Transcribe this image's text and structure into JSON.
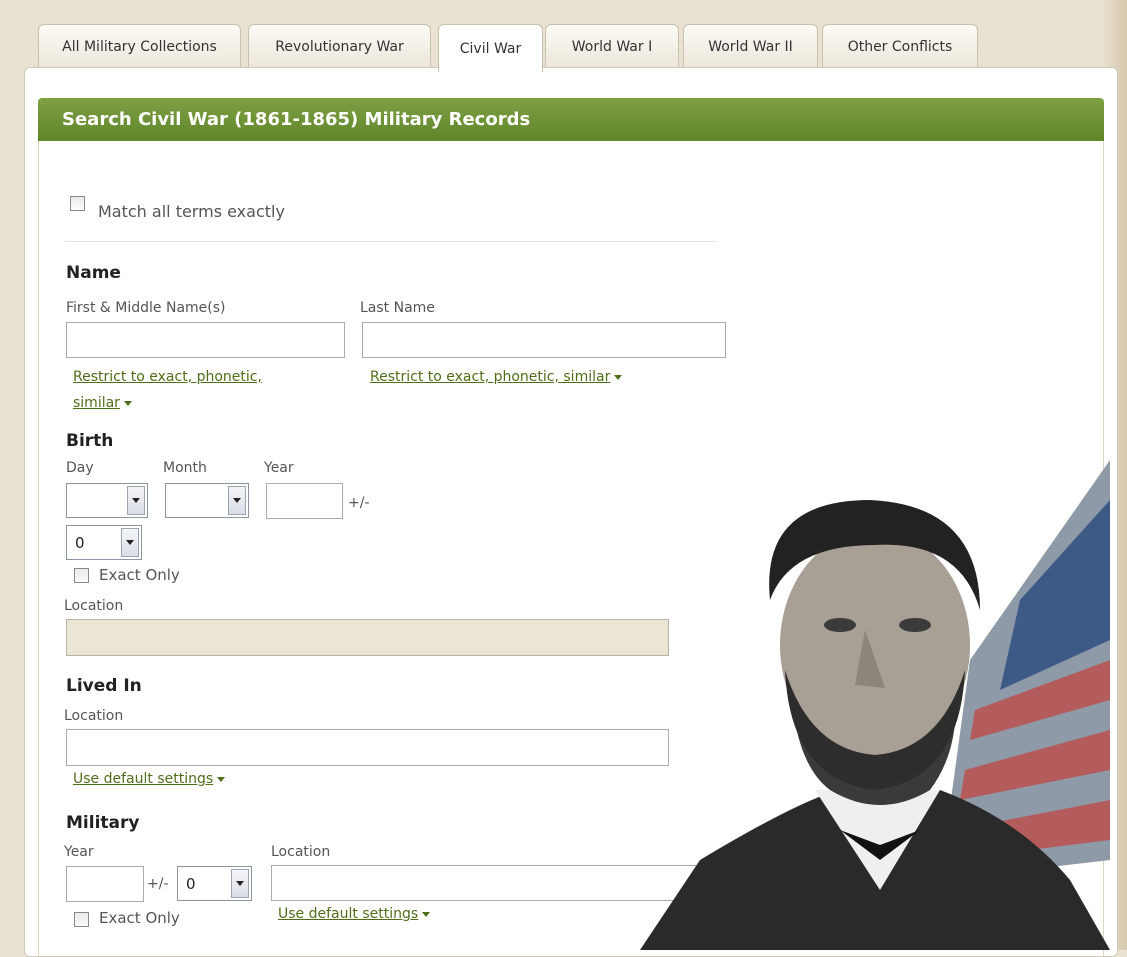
{
  "tabs": [
    {
      "label": "All Military Collections",
      "active": false
    },
    {
      "label": "Revolutionary War",
      "active": false
    },
    {
      "label": "Civil War",
      "active": true
    },
    {
      "label": "World War I",
      "active": false
    },
    {
      "label": "World War II",
      "active": false
    },
    {
      "label": "Other Conflicts",
      "active": false
    }
  ],
  "header": {
    "title": "Search Civil War (1861-1865) Military Records"
  },
  "match_exact": {
    "label": "Match all terms exactly",
    "checked": false
  },
  "name": {
    "title": "Name",
    "first_label": "First & Middle Name(s)",
    "last_label": "Last Name",
    "first_value": "",
    "last_value": "",
    "restrict_first_line1": "Restrict to exact, phonetic,",
    "restrict_first_line2": "similar",
    "restrict_last": "Restrict to exact, phonetic, similar"
  },
  "birth": {
    "title": "Birth",
    "day_label": "Day",
    "month_label": "Month",
    "year_label": "Year",
    "day_value": "",
    "month_value": "",
    "year_value": "",
    "plusminus": "+/-",
    "range_value": "0",
    "exact_label": "Exact Only",
    "location_label": "Location",
    "location_value": ""
  },
  "lived_in": {
    "title": "Lived In",
    "location_label": "Location",
    "location_value": "",
    "settings_link": "Use default settings"
  },
  "military": {
    "title": "Military",
    "year_label": "Year",
    "location_label": "Location",
    "year_value": "",
    "plusminus": "+/-",
    "range_value": "0",
    "location_value": "",
    "exact_label": "Exact Only",
    "settings_link": "Use default settings"
  },
  "colors": {
    "header_green": "#6a8f31",
    "link_green": "#4f6e1a",
    "page_bg": "#e9e1d2"
  }
}
